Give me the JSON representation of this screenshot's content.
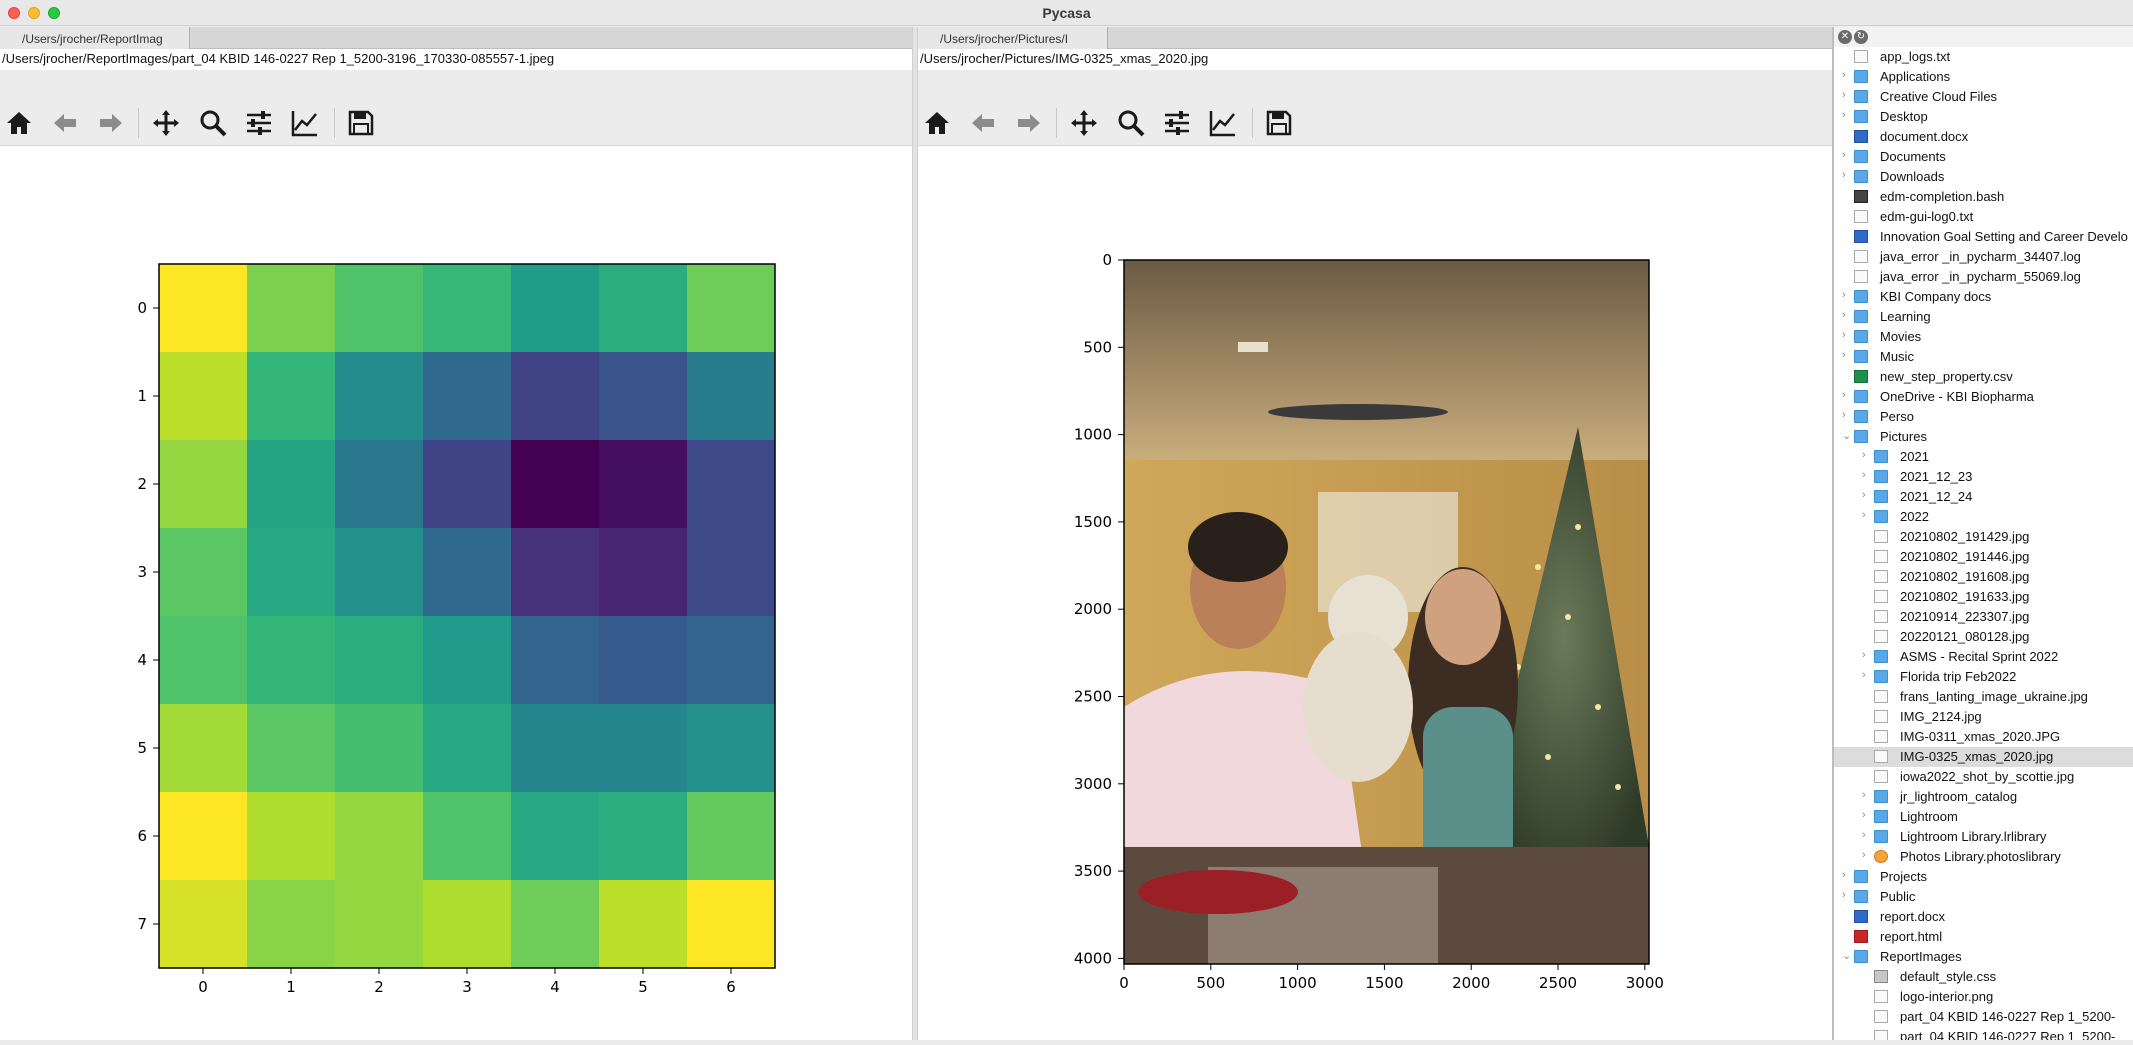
{
  "window": {
    "title": "Pycasa"
  },
  "left_pane": {
    "tab_label": "/Users/jrocher/ReportImag",
    "path": "/Users/jrocher/ReportImages/part_04 KBID 146-0227 Rep 1_5200-3196_170330-085557-1.jpeg",
    "toolbar": [
      "home-icon",
      "back-arrow-icon",
      "forward-arrow-icon",
      "pan-icon",
      "zoom-icon",
      "configure-subplots-icon",
      "edit-axis-icon",
      "save-icon"
    ]
  },
  "right_pane": {
    "tab_label": "/Users/jrocher/Pictures/I",
    "path": "/Users/jrocher/Pictures/IMG-0325_xmas_2020.jpg",
    "toolbar": [
      "home-icon",
      "back-arrow-icon",
      "forward-arrow-icon",
      "pan-icon",
      "zoom-icon",
      "configure-subplots-icon",
      "edit-axis-icon",
      "save-icon"
    ]
  },
  "chart_data": [
    {
      "type": "heatmap",
      "colormap": "viridis",
      "x_ticks": [
        "0",
        "1",
        "2",
        "3",
        "4",
        "5",
        "6"
      ],
      "y_ticks": [
        "0",
        "1",
        "2",
        "3",
        "4",
        "5",
        "6",
        "7"
      ],
      "values": [
        [
          1.0,
          0.8,
          0.72,
          0.67,
          0.55,
          0.62,
          0.78
        ],
        [
          0.9,
          0.66,
          0.48,
          0.34,
          0.2,
          0.26,
          0.42
        ],
        [
          0.84,
          0.58,
          0.4,
          0.2,
          0.0,
          0.04,
          0.22
        ],
        [
          0.74,
          0.6,
          0.5,
          0.34,
          0.14,
          0.1,
          0.22
        ],
        [
          0.72,
          0.66,
          0.62,
          0.54,
          0.32,
          0.28,
          0.32
        ],
        [
          0.86,
          0.74,
          0.7,
          0.6,
          0.46,
          0.46,
          0.5
        ],
        [
          1.0,
          0.88,
          0.84,
          0.72,
          0.6,
          0.62,
          0.76
        ],
        [
          0.94,
          0.82,
          0.84,
          0.88,
          0.78,
          0.9,
          1.0
        ]
      ]
    },
    {
      "type": "image",
      "x_ticks": [
        "0",
        "500",
        "1000",
        "1500",
        "2000",
        "2500",
        "3000"
      ],
      "y_ticks": [
        "0",
        "500",
        "1000",
        "1500",
        "2000",
        "2500",
        "3000",
        "3500",
        "4000"
      ]
    }
  ],
  "sidebar": {
    "controls": [
      "close-icon",
      "refresh-icon"
    ],
    "items": [
      {
        "label": "app_logs.txt",
        "depth": 0,
        "kind": "file",
        "chev": ""
      },
      {
        "label": "Applications",
        "depth": 0,
        "kind": "folder",
        "chev": ">"
      },
      {
        "label": "Creative Cloud Files",
        "depth": 0,
        "kind": "folder",
        "chev": ">"
      },
      {
        "label": "Desktop",
        "depth": 0,
        "kind": "folder",
        "chev": ">"
      },
      {
        "label": "document.docx",
        "depth": 0,
        "kind": "docx",
        "chev": ""
      },
      {
        "label": "Documents",
        "depth": 0,
        "kind": "folder",
        "chev": ">"
      },
      {
        "label": "Downloads",
        "depth": 0,
        "kind": "folder",
        "chev": ">"
      },
      {
        "label": "edm-completion.bash",
        "depth": 0,
        "kind": "bash",
        "chev": ""
      },
      {
        "label": "edm-gui-log0.txt",
        "depth": 0,
        "kind": "file",
        "chev": ""
      },
      {
        "label": "Innovation Goal Setting and Career Develo",
        "depth": 0,
        "kind": "docx",
        "chev": ""
      },
      {
        "label": "java_error _in_pycharm_34407.log",
        "depth": 0,
        "kind": "file",
        "chev": ""
      },
      {
        "label": "java_error _in_pycharm_55069.log",
        "depth": 0,
        "kind": "file",
        "chev": ""
      },
      {
        "label": "KBI Company docs",
        "depth": 0,
        "kind": "folder",
        "chev": ">"
      },
      {
        "label": "Learning",
        "depth": 0,
        "kind": "folder",
        "chev": ">"
      },
      {
        "label": "Movies",
        "depth": 0,
        "kind": "folder",
        "chev": ">"
      },
      {
        "label": "Music",
        "depth": 0,
        "kind": "folder",
        "chev": ">"
      },
      {
        "label": "new_step_property.csv",
        "depth": 0,
        "kind": "csv",
        "chev": ""
      },
      {
        "label": "OneDrive - KBI Biopharma",
        "depth": 0,
        "kind": "folder",
        "chev": ">"
      },
      {
        "label": "Perso",
        "depth": 0,
        "kind": "folder",
        "chev": ">"
      },
      {
        "label": "Pictures",
        "depth": 0,
        "kind": "folder",
        "chev": "v"
      },
      {
        "label": "2021",
        "depth": 1,
        "kind": "folder",
        "chev": ">"
      },
      {
        "label": "2021_12_23",
        "depth": 1,
        "kind": "folder",
        "chev": ">"
      },
      {
        "label": "2021_12_24",
        "depth": 1,
        "kind": "folder",
        "chev": ">"
      },
      {
        "label": "2022",
        "depth": 1,
        "kind": "folder",
        "chev": ">"
      },
      {
        "label": "20210802_191429.jpg",
        "depth": 1,
        "kind": "file",
        "chev": ""
      },
      {
        "label": "20210802_191446.jpg",
        "depth": 1,
        "kind": "file",
        "chev": ""
      },
      {
        "label": "20210802_191608.jpg",
        "depth": 1,
        "kind": "file",
        "chev": ""
      },
      {
        "label": "20210802_191633.jpg",
        "depth": 1,
        "kind": "file",
        "chev": ""
      },
      {
        "label": "20210914_223307.jpg",
        "depth": 1,
        "kind": "file",
        "chev": ""
      },
      {
        "label": "20220121_080128.jpg",
        "depth": 1,
        "kind": "file",
        "chev": ""
      },
      {
        "label": "ASMS - Recital Sprint 2022",
        "depth": 1,
        "kind": "folder",
        "chev": ">"
      },
      {
        "label": "Florida trip Feb2022",
        "depth": 1,
        "kind": "folder",
        "chev": ">"
      },
      {
        "label": "frans_lanting_image_ukraine.jpg",
        "depth": 1,
        "kind": "file",
        "chev": ""
      },
      {
        "label": "IMG_2124.jpg",
        "depth": 1,
        "kind": "file",
        "chev": ""
      },
      {
        "label": "IMG-0311_xmas_2020.JPG",
        "depth": 1,
        "kind": "file",
        "chev": ""
      },
      {
        "label": "IMG-0325_xmas_2020.jpg",
        "depth": 1,
        "kind": "file",
        "chev": "",
        "selected": true
      },
      {
        "label": "iowa2022_shot_by_scottie.jpg",
        "depth": 1,
        "kind": "file",
        "chev": ""
      },
      {
        "label": "jr_lightroom_catalog",
        "depth": 1,
        "kind": "folder",
        "chev": ">"
      },
      {
        "label": "Lightroom",
        "depth": 1,
        "kind": "folder",
        "chev": ">"
      },
      {
        "label": "Lightroom Library.lrlibrary",
        "depth": 1,
        "kind": "folder",
        "chev": ">"
      },
      {
        "label": "Photos Library.photoslibrary",
        "depth": 1,
        "kind": "lib",
        "chev": ">"
      },
      {
        "label": "Projects",
        "depth": 0,
        "kind": "folder",
        "chev": ">"
      },
      {
        "label": "Public",
        "depth": 0,
        "kind": "folder",
        "chev": ">"
      },
      {
        "label": "report.docx",
        "depth": 0,
        "kind": "docx",
        "chev": ""
      },
      {
        "label": "report.html",
        "depth": 0,
        "kind": "html",
        "chev": ""
      },
      {
        "label": "ReportImages",
        "depth": 0,
        "kind": "folder",
        "chev": "v"
      },
      {
        "label": "default_style.css",
        "depth": 1,
        "kind": "css",
        "chev": ""
      },
      {
        "label": "logo-interior.png",
        "depth": 1,
        "kind": "file",
        "chev": ""
      },
      {
        "label": "part_04 KBID 146-0227 Rep 1_5200-",
        "depth": 1,
        "kind": "file",
        "chev": ""
      },
      {
        "label": "part_04 KBID 146-0227 Rep 1_5200-",
        "depth": 1,
        "kind": "file",
        "chev": ""
      }
    ]
  }
}
